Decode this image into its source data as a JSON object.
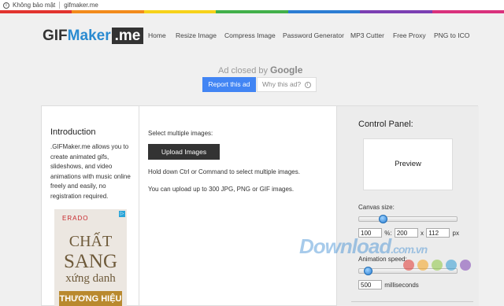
{
  "browser": {
    "security_text": "Không bảo mật",
    "url": "gifmaker.me"
  },
  "brand": {
    "logo_gif": "GIF",
    "logo_maker": "Maker",
    "logo_me": ".me",
    "colors": {
      "accent_blue": "#2a8bd1",
      "dark": "#333333",
      "report_blue": "#4285f4",
      "strip": [
        "#e2342f",
        "#f28b1c",
        "#f6d21a",
        "#42b04a",
        "#2b7cd3",
        "#7b3fb2",
        "#d9317c"
      ]
    }
  },
  "nav": {
    "items": [
      "Home",
      "Resize Image",
      "Compress Image",
      "Password Generator",
      "MP3 Cutter",
      "Free Proxy",
      "PNG to ICO"
    ]
  },
  "ad_notice": {
    "closed_by": "Ad closed by",
    "google": "Google",
    "report_label": "Report this ad",
    "why_label": "Why this ad?",
    "why_icon": "info-icon"
  },
  "intro": {
    "title": "Introduction",
    "text": ".GIFMaker.me allows you to create animated gifs, slideshows, and video animations with music online freely and easily, no registration required."
  },
  "side_ad": {
    "brand": "ERADO",
    "line1": "CHẤT",
    "line2": "SANG",
    "line3": "xứng danh",
    "line4": "THƯƠNG HIỆU"
  },
  "upload": {
    "select_label": "Select multiple images:",
    "button_label": "Upload Images",
    "hint_ctrl": "Hold down Ctrl or Command to select multiple images.",
    "hint_limit": "You can upload up to 300 JPG, PNG or GIF images."
  },
  "control_panel": {
    "title": "Control Panel:",
    "preview_label": "Preview",
    "canvas_size_label": "Canvas size:",
    "canvas_slider_level": 0.22,
    "percent_value": "100",
    "percent_sign": "%:",
    "width_value": "200",
    "x_sign": "x",
    "height_value": "112",
    "px_unit": "px",
    "animation_speed_label": "Animation speed:",
    "speed_slider_level": 0.05,
    "speed_value": "500",
    "speed_unit": "milliseconds"
  },
  "watermark": {
    "text": "Download",
    "domain": ".com.vn",
    "dot_colors": [
      "#e2342f",
      "#f6a21a",
      "#8cc63f",
      "#2b9bd3",
      "#7b3fb2"
    ]
  }
}
